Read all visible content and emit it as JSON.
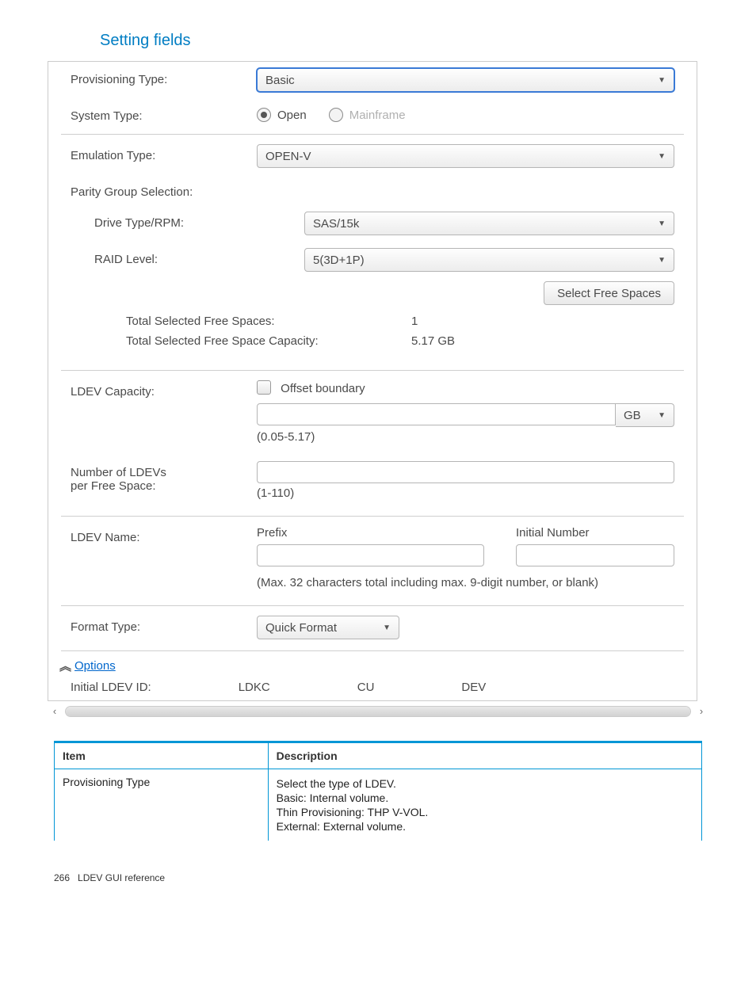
{
  "section_title": "Setting fields",
  "form": {
    "provisioning_type": {
      "label": "Provisioning Type:",
      "value": "Basic"
    },
    "system_type": {
      "label": "System Type:",
      "options": {
        "open": "Open",
        "mainframe": "Mainframe"
      },
      "selected": "open"
    },
    "emulation_type": {
      "label": "Emulation Type:",
      "value": "OPEN-V"
    },
    "parity_group_selection": {
      "label": "Parity Group Selection:"
    },
    "drive_type": {
      "label": "Drive Type/RPM:",
      "value": "SAS/15k"
    },
    "raid_level": {
      "label": "RAID Level:",
      "value": "5(3D+1P)"
    },
    "select_free_spaces_btn": "Select Free Spaces",
    "total_free_spaces": {
      "label": "Total Selected Free Spaces:",
      "value": "1"
    },
    "total_free_capacity": {
      "label": "Total Selected Free Space Capacity:",
      "value": "5.17 GB"
    },
    "ldev_capacity": {
      "label": "LDEV Capacity:",
      "offset_label": "Offset boundary",
      "unit": "GB",
      "range": "(0.05-5.17)"
    },
    "num_ldevs": {
      "label_l1": "Number of LDEVs",
      "label_l2": "per Free Space:",
      "range": "(1-110)"
    },
    "ldev_name": {
      "label": "LDEV Name:",
      "prefix_label": "Prefix",
      "initial_label": "Initial Number",
      "hint": "(Max. 32 characters total including max. 9-digit number, or blank)"
    },
    "format_type": {
      "label": "Format Type:",
      "value": "Quick Format"
    },
    "options_link": "Options",
    "initial_ldev": {
      "label": "Initial LDEV ID:",
      "ldkc": "LDKC",
      "cu": "CU",
      "dev": "DEV"
    }
  },
  "table": {
    "headers": {
      "item": "Item",
      "desc": "Description"
    },
    "rows": [
      {
        "item": "Provisioning Type",
        "desc": [
          "Select the type of LDEV.",
          "Basic: Internal volume.",
          "Thin Provisioning: THP V-VOL.",
          "External: External volume."
        ]
      }
    ]
  },
  "footer": {
    "page_no": "266",
    "chapter": "LDEV GUI reference"
  }
}
